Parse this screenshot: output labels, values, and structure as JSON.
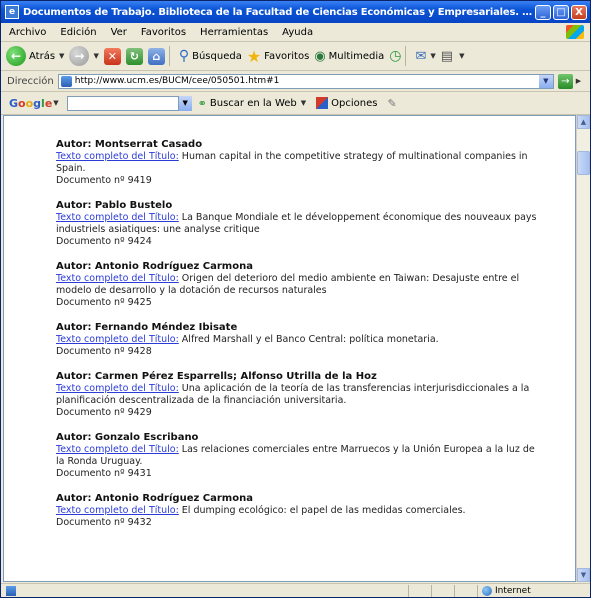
{
  "window": {
    "title": "Documentos de Trabajo. Biblioteca de la Facultad de Ciencias Económicas y Empresariales. Univer - Microsoft...",
    "buttons": {
      "minimize": "_",
      "maximize": "□",
      "close": "X"
    }
  },
  "menu": [
    "Archivo",
    "Edición",
    "Ver",
    "Favoritos",
    "Herramientas",
    "Ayuda"
  ],
  "toolbar": {
    "back_label": "Atrás",
    "search_label": "Búsqueda",
    "favorites_label": "Favoritos",
    "media_label": "Multimedia"
  },
  "address": {
    "label": "Dirección",
    "url": "http://www.ucm.es/BUCM/cee/050501.htm#1",
    "go_label": ""
  },
  "google": {
    "logo": [
      "G",
      "o",
      "o",
      "g",
      "l",
      "e"
    ],
    "search_web_label": "Buscar en la Web",
    "options_label": "Opciones"
  },
  "entries": [
    {
      "author": "Autor: Montserrat Casado",
      "link": "Texto completo del Título:",
      "title": " Human capital in the competitive strategy of multinational companies in Spain.",
      "doc": "Documento nº 9419"
    },
    {
      "author": "Autor: Pablo Bustelo",
      "link": "Texto completo del Título:",
      "title": " La Banque Mondiale et le développement économique des nouveaux pays industriels asiatiques: une analyse critique",
      "doc": "Documento nº 9424"
    },
    {
      "author": "Autor: Antonio Rodríguez Carmona",
      "link": "Texto completo del Título:",
      "title": " Origen del deterioro del medio ambiente en Taiwan: Desajuste entre el modelo de desarrollo y la dotación de recursos naturales",
      "doc": "Documento nº 9425"
    },
    {
      "author": "Autor: Fernando Méndez Ibisate",
      "link": "Texto completo del Título:",
      "title": " Alfred Marshall y el Banco Central: política monetaria.",
      "doc": "Documento nº 9428"
    },
    {
      "author": "Autor: Carmen Pérez Esparrells; Alfonso Utrilla de la Hoz",
      "link": "Texto completo del Título:",
      "title": " Una aplicación de la teoría de las transferencias interjurisdiccionales a la planificación descentralizada de la financiación universitaria.",
      "doc": "Documento nº 9429"
    },
    {
      "author": "Autor: Gonzalo Escribano",
      "link": "Texto completo del Título:",
      "title": " Las relaciones comerciales entre Marruecos y la Unión Europea a la luz de la Ronda Uruguay.",
      "doc": "Documento nº 9431"
    },
    {
      "author": "Autor: Antonio Rodríguez Carmona",
      "link": "Texto completo del Título:",
      "title": " El dumping ecológico: el papel de las medidas comerciales.",
      "doc": "Documento nº 9432"
    }
  ],
  "status": {
    "zone": "Internet"
  }
}
